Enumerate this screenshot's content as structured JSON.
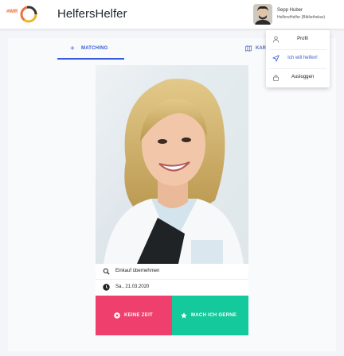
{
  "header": {
    "logo_text": "#WIR",
    "app_title": "HelfersHelfer",
    "user": {
      "name": "Sepp Huber",
      "role": "HelfersHelfer (Bibliothekar)"
    }
  },
  "tabs": [
    {
      "label": "MATCHING",
      "icon": "plus-icon",
      "active": true
    },
    {
      "label": "KARTE",
      "icon": "map-icon",
      "active": false
    }
  ],
  "user_menu": [
    {
      "label": "Profil",
      "icon": "user-icon"
    },
    {
      "label": "Ich will helfen!",
      "icon": "send-icon",
      "active": true
    },
    {
      "label": "Ausloggen",
      "icon": "lock-icon"
    }
  ],
  "match_card": {
    "task": "Einkauf übernehmen",
    "date": "Sa., 21.03.2020",
    "decline_label": "KEINE ZEIT",
    "accept_label": "MACH ICH GERNE"
  },
  "colors": {
    "accent": "#3b5bdb",
    "decline": "#ee3f6d",
    "accept": "#14c99b"
  }
}
